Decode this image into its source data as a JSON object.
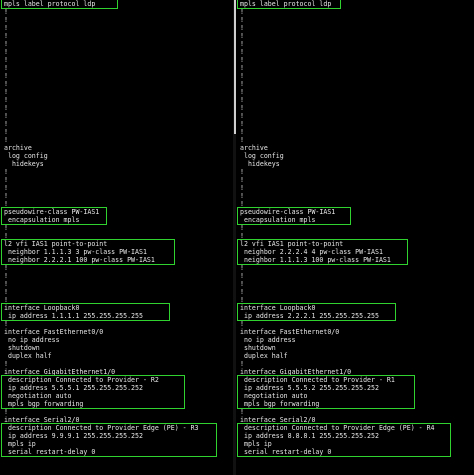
{
  "colors": {
    "background": "#000000",
    "text": "#e6e6e6",
    "highlight_box": "#2fd22f"
  },
  "left_pane": {
    "line_0": "mpls label protocol ldp",
    "line_1": "!",
    "line_2": "!",
    "line_3": "!",
    "line_4": "!",
    "line_5": "!",
    "line_6": "!",
    "line_7": "!",
    "line_8": "!",
    "line_9": "!",
    "line_10": "!",
    "line_11": "!",
    "line_12": "!",
    "line_13": "!",
    "line_14": "!",
    "line_15": "!",
    "line_16": "!",
    "line_17": "!",
    "line_18": "archive",
    "line_19": " log config",
    "line_20": "  hidekeys",
    "line_21": "!",
    "line_22": "!",
    "line_23": "!",
    "line_24": "!",
    "line_25": "!",
    "line_26": "pseudowire-class PW-IAS1",
    "line_27": " encapsulation mpls",
    "line_28": "!",
    "line_29": "!",
    "line_30": "l2 vfi IAS1 point-to-point",
    "line_31": " neighbor 1.1.1.3 3 pw-class PW-IAS1",
    "line_32": " neighbor 2.2.2.1 100 pw-class PW-IAS1",
    "line_33": "!",
    "line_34": "!",
    "line_35": "!",
    "line_36": "!",
    "line_37": "!",
    "line_38": "interface Loopback0",
    "line_39": " ip address 1.1.1.1 255.255.255.255",
    "line_40": "!",
    "line_41": "interface FastEthernet0/0",
    "line_42": " no ip address",
    "line_43": " shutdown",
    "line_44": " duplex half",
    "line_45": "!",
    "line_46": "interface GigabitEthernet1/0",
    "line_47": " description Connected to Provider - R2",
    "line_48": " ip address 5.5.5.1 255.255.255.252",
    "line_49": " negotiation auto",
    "line_50": " mpls bgp forwarding",
    "line_51": "!",
    "line_52": "interface Serial2/0",
    "line_53": " description Connected to Provider Edge (PE) - R3",
    "line_54": " ip address 9.9.9.1 255.255.255.252",
    "line_55": " mpls ip",
    "line_56": " serial restart-delay 0"
  },
  "right_pane": {
    "line_0": "mpls label protocol ldp",
    "line_1": "!",
    "line_2": "!",
    "line_3": "!",
    "line_4": "!",
    "line_5": "!",
    "line_6": "!",
    "line_7": "!",
    "line_8": "!",
    "line_9": "!",
    "line_10": "!",
    "line_11": "!",
    "line_12": "!",
    "line_13": "!",
    "line_14": "!",
    "line_15": "!",
    "line_16": "!",
    "line_17": "!",
    "line_18": "archive",
    "line_19": " log config",
    "line_20": "  hidekeys",
    "line_21": "!",
    "line_22": "!",
    "line_23": "!",
    "line_24": "!",
    "line_25": "!",
    "line_26": "pseudowire-class PW-IAS1",
    "line_27": " encapsulation mpls",
    "line_28": "!",
    "line_29": "!",
    "line_30": "l2 vfi IAS1 point-to-point",
    "line_31": " neighbor 2.2.2.4 4 pw-class PW-IAS1",
    "line_32": " neighbor 1.1.1.3 100 pw-class PW-IAS1",
    "line_33": "!",
    "line_34": "!",
    "line_35": "!",
    "line_36": "!",
    "line_37": "!",
    "line_38": "interface Loopback0",
    "line_39": " ip address 2.2.2.1 255.255.255.255",
    "line_40": "!",
    "line_41": "interface FastEthernet0/0",
    "line_42": " no ip address",
    "line_43": " shutdown",
    "line_44": " duplex half",
    "line_45": "!",
    "line_46": "interface GigabitEthernet1/0",
    "line_47": " description Connected to Provider - R1",
    "line_48": " ip address 5.5.5.2 255.255.255.252",
    "line_49": " negotiation auto",
    "line_50": " mpls bgp forwarding",
    "line_51": "!",
    "line_52": "interface Serial2/0",
    "line_53": " description Connected to Provider Edge (PE) - R4",
    "line_54": " ip address 8.8.8.1 255.255.255.252",
    "line_55": " mpls ip",
    "line_56": " serial restart-delay 0"
  }
}
